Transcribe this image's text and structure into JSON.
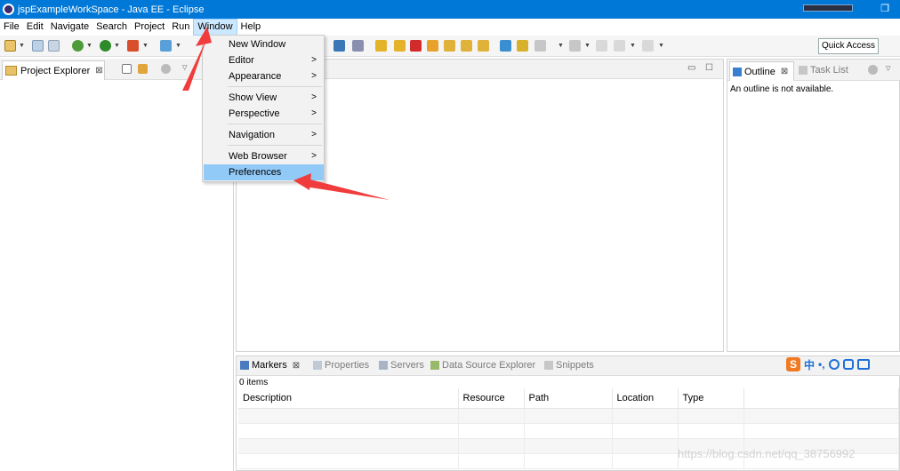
{
  "window": {
    "title": "jspExampleWorkSpace - Java EE - Eclipse"
  },
  "menubar": {
    "items": [
      {
        "label": "File"
      },
      {
        "label": "Edit"
      },
      {
        "label": "Navigate"
      },
      {
        "label": "Search"
      },
      {
        "label": "Project"
      },
      {
        "label": "Run"
      },
      {
        "label": "Window"
      },
      {
        "label": "Help"
      }
    ]
  },
  "window_menu": {
    "items": [
      {
        "label": "New Window",
        "submenu": false
      },
      {
        "label": "Editor",
        "submenu": true
      },
      {
        "label": "Appearance",
        "submenu": true
      },
      {
        "label": "Show View",
        "submenu": true
      },
      {
        "label": "Perspective",
        "submenu": true
      },
      {
        "label": "Navigation",
        "submenu": true
      },
      {
        "label": "Web Browser",
        "submenu": true
      },
      {
        "label": "Preferences",
        "submenu": false,
        "highlighted": true
      }
    ],
    "submenu_glyph": ">"
  },
  "toolbar": {
    "quick_access": "Quick Access"
  },
  "project_explorer": {
    "tab_label": "Project Explorer",
    "close_glyph": "⊠"
  },
  "outline": {
    "tab_label": "Outline",
    "task_list_label": "Task List",
    "close_glyph": "⊠",
    "message": "An outline is not available."
  },
  "markers": {
    "tabs": [
      {
        "label": "Markers",
        "active": true
      },
      {
        "label": "Properties",
        "active": false
      },
      {
        "label": "Servers",
        "active": false
      },
      {
        "label": "Data Source Explorer",
        "active": false
      },
      {
        "label": "Snippets",
        "active": false
      }
    ],
    "close_glyph": "⊠",
    "items_count": "0 items",
    "columns": [
      "Description",
      "Resource",
      "Path",
      "Location",
      "Type"
    ]
  },
  "ime": {
    "logo": "S",
    "lang": "中",
    "punct": "•,"
  },
  "watermark": "https://blog.csdn.net/qq_38756992",
  "colors": {
    "titlebar": "#0078d7",
    "menu_highlight": "#91c9f7",
    "annotation_arrow": "#f03c3c"
  }
}
